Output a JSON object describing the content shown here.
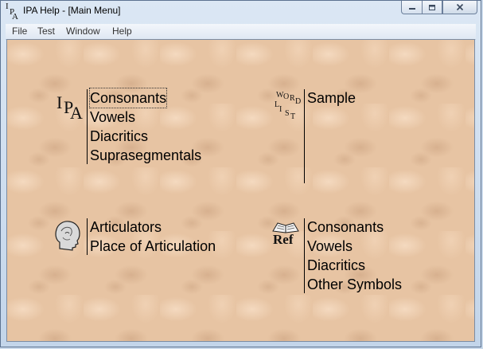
{
  "window": {
    "title": "IPA Help - [Main Menu]",
    "app_icon_letters": [
      "I",
      "P",
      "A"
    ]
  },
  "menubar": {
    "items": [
      "File",
      "Test",
      "Window",
      "Help"
    ]
  },
  "groups": {
    "ipa": {
      "icon": "ipa-logo-icon",
      "icon_letters": [
        "I",
        "P",
        "A"
      ],
      "items": [
        "Consonants",
        "Vowels",
        "Diacritics",
        "Suprasegmentals"
      ]
    },
    "wordlist": {
      "icon": "word-list-icon",
      "icon_letters": [
        "W",
        "O",
        "R",
        "D",
        "L",
        "I",
        "S",
        "T"
      ],
      "items": [
        "Sample"
      ]
    },
    "head": {
      "icon": "head-profile-icon",
      "items": [
        "Articulators",
        "Place of Articulation"
      ]
    },
    "reference": {
      "icon": "reference-book-icon",
      "icon_text": "Ref",
      "items": [
        "Consonants",
        "Vowels",
        "Diacritics",
        "Other Symbols"
      ]
    }
  },
  "colors": {
    "background": "#e7c4a3",
    "text": "#000000"
  }
}
